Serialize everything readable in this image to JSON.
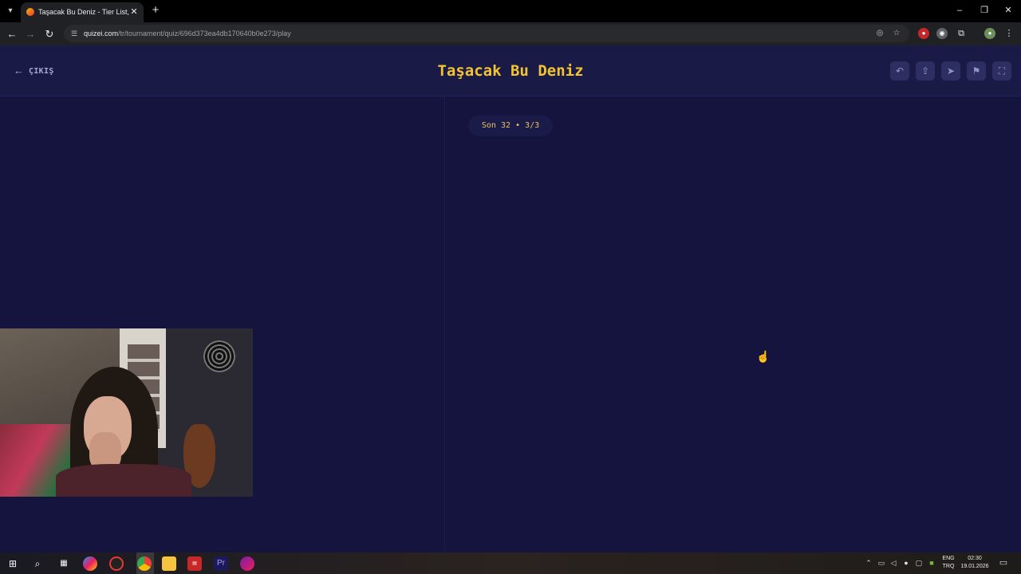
{
  "browser": {
    "tab_title": "Taşacak Bu Deniz - Tier List, Kö",
    "url_host": "quizei.com",
    "url_path": "/tr/tournament/quiz/696d373ea4db170640b0e273/play"
  },
  "header": {
    "exit_label": "ÇIKIŞ",
    "title": "Taşacak Bu Deniz"
  },
  "round_badge": "Son 32 • 3/3",
  "taskbar": {
    "lang_top": "ENG",
    "lang_bottom": "TRQ",
    "time": "02:30",
    "date": "19.01.2026"
  },
  "colors": {
    "page_bg": "#14143e",
    "header_bg": "#1a1a47",
    "title": "#f4c430",
    "badge_text": "#e8c25a"
  },
  "icons": [
    "tab-list-icon",
    "close-icon",
    "plus-icon",
    "back-icon",
    "forward-icon",
    "reload-icon",
    "site-info-icon",
    "eye-off-icon",
    "star-icon",
    "extension-icon",
    "profile-icon",
    "menu-icon",
    "arrow-left-icon",
    "undo-icon",
    "share-icon",
    "send-icon",
    "flag-icon",
    "fullscreen-icon",
    "windows-icon",
    "search-icon"
  ]
}
